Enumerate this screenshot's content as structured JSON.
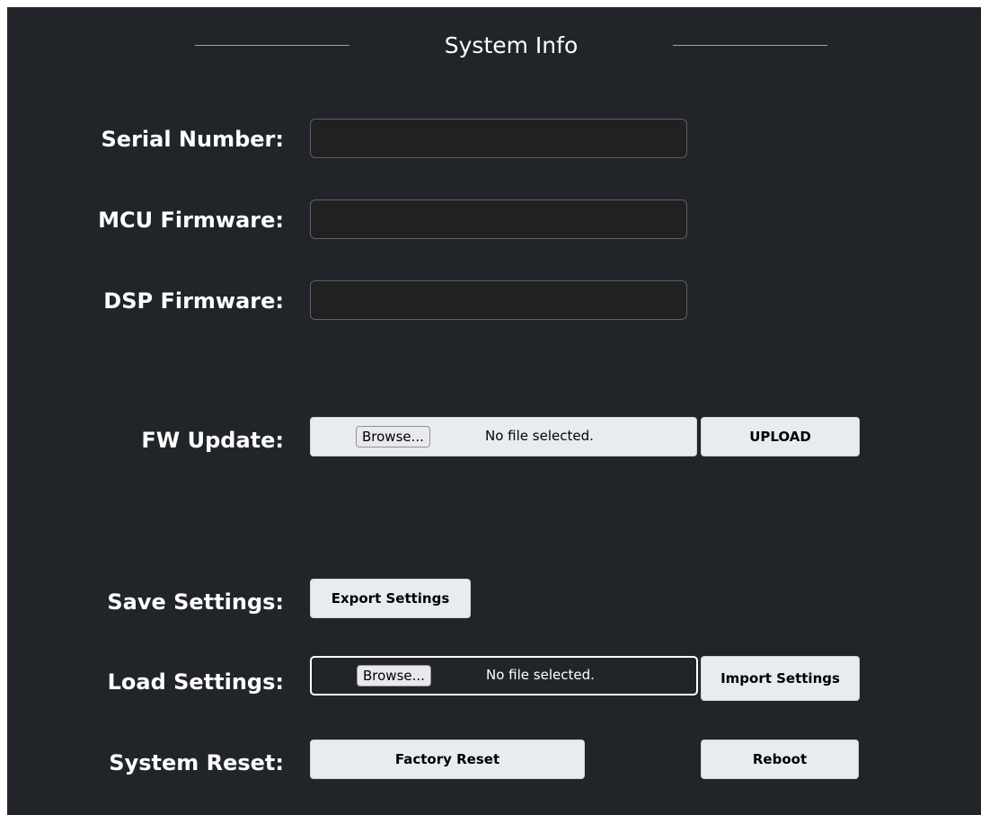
{
  "header": {
    "title": "System Info"
  },
  "fields": {
    "serial_label": "Serial Number:",
    "serial_value": "",
    "mcu_label": "MCU Firmware:",
    "mcu_value": "",
    "dsp_label": "DSP Firmware:",
    "dsp_value": ""
  },
  "fw_update": {
    "label": "FW Update:",
    "browse_label": "Browse...",
    "file_status": "No file selected.",
    "upload_label": "UPLOAD"
  },
  "save_settings": {
    "label": "Save Settings:",
    "export_label": "Export Settings"
  },
  "load_settings": {
    "label": "Load Settings:",
    "browse_label": "Browse...",
    "file_status": "No file selected.",
    "import_label": "Import Settings"
  },
  "system_reset": {
    "label": "System Reset:",
    "factory_reset_label": "Factory Reset",
    "reboot_label": "Reboot"
  },
  "colors": {
    "background": "#212529",
    "button": "#e9ecef",
    "text": "#ffffff"
  }
}
